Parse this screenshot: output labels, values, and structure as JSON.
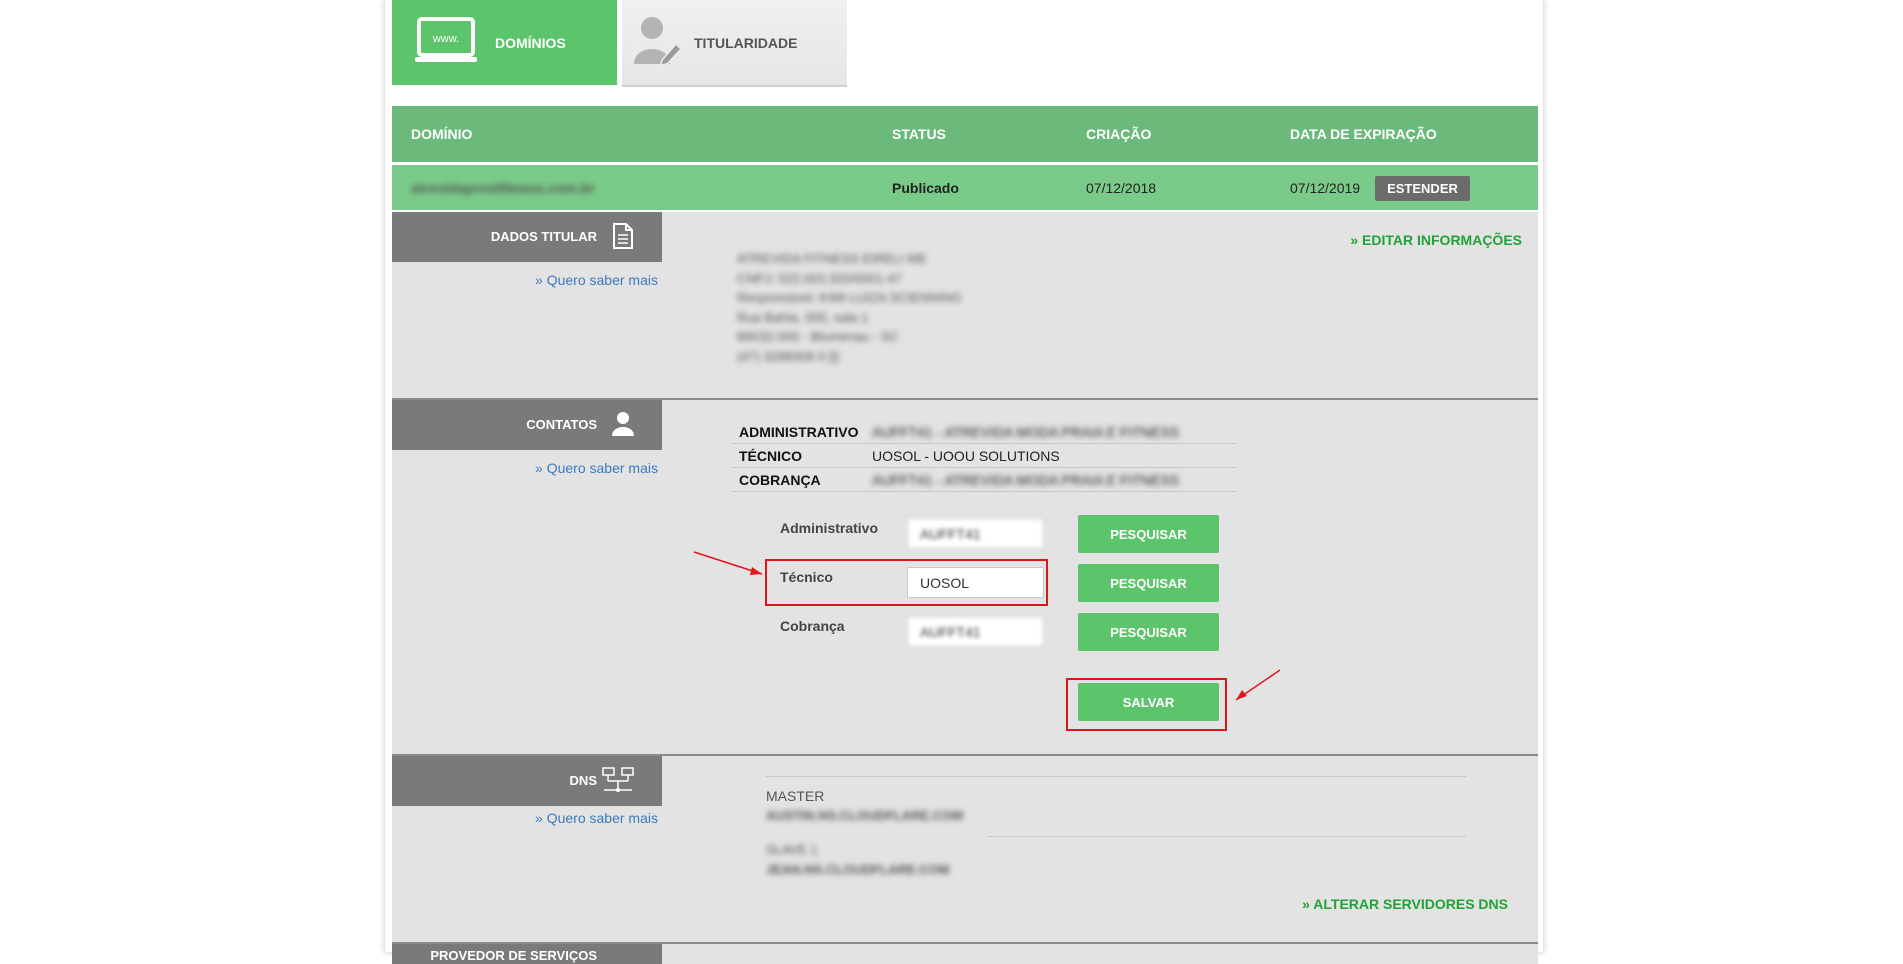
{
  "tabs": [
    {
      "label": "DOMÍNIOS",
      "icon": "browser-www-icon",
      "active": true
    },
    {
      "label": "TITULARIDADE",
      "icon": "user-edit-icon",
      "active": false
    }
  ],
  "table": {
    "headers": {
      "dominio": "DOMÍNIO",
      "status": "STATUS",
      "criacao": "CRIAÇÃO",
      "expiracao": "DATA DE EXPIRAÇÃO"
    },
    "row": {
      "dominio": "atrevidaprestfitness.com.br",
      "status": "Publicado",
      "criacao": "07/12/2018",
      "expiracao": "07/12/2019",
      "action": "ESTENDER"
    }
  },
  "titular": {
    "title": "DADOS TITULAR",
    "saber_mais": "» Quero saber mais",
    "edit_link": "» EDITAR INFORMAÇÕES",
    "lines": [
      "ATREVIDA FITNESS EIRELI ME",
      "CNPJ: 022.003.320/0001-47",
      "Responsável: KIMI LUIZA SCIENNING",
      "Rua Bahia, 000, sala 1",
      "89032-000 - Blumenau - SC",
      "(47) 3288308 0 [i]"
    ]
  },
  "contatos": {
    "title": "CONTATOS",
    "saber_mais": "» Quero saber mais",
    "table": [
      {
        "key": "ADMINISTRATIVO",
        "value": "AUFFT41 - ATREVIDA MODA PRAIA E FITNESS",
        "blurred": true
      },
      {
        "key": "TÉCNICO",
        "value": "UOSOL - UOOU SOLUTIONS",
        "blurred": false
      },
      {
        "key": "COBRANÇA",
        "value": "AUFFT41 - ATREVIDA MODA PRAIA E FITNESS",
        "blurred": true
      }
    ],
    "form": {
      "administrativo_label": "Administrativo",
      "administrativo_value": "AUFFT41",
      "tecnico_label": "Técnico",
      "tecnico_value": "UOSOL",
      "cobranca_label": "Cobrança",
      "cobranca_value": "AUFFT41",
      "search_label": "PESQUISAR",
      "save_label": "SALVAR"
    }
  },
  "dns": {
    "title": "DNS",
    "saber_mais": "» Quero saber mais",
    "master_label": "MASTER",
    "master_value": "AUSTIN.NS.CLOUDFLARE.COM",
    "slave_label": "SLAVE 1",
    "slave_value": "JEAN.NS.CLOUDFLARE.COM",
    "alter_link": "» ALTERAR SERVIDORES DNS"
  },
  "provedor": {
    "title": "PROVEDOR DE SERVIÇOS"
  },
  "colors": {
    "green": "#5cc46b",
    "header_green": "#6cb97c",
    "row_green": "#7acb8a",
    "section_gray": "#e3e3e3",
    "head_gray": "#7a7a7a",
    "annotation_red": "#e0151b"
  }
}
